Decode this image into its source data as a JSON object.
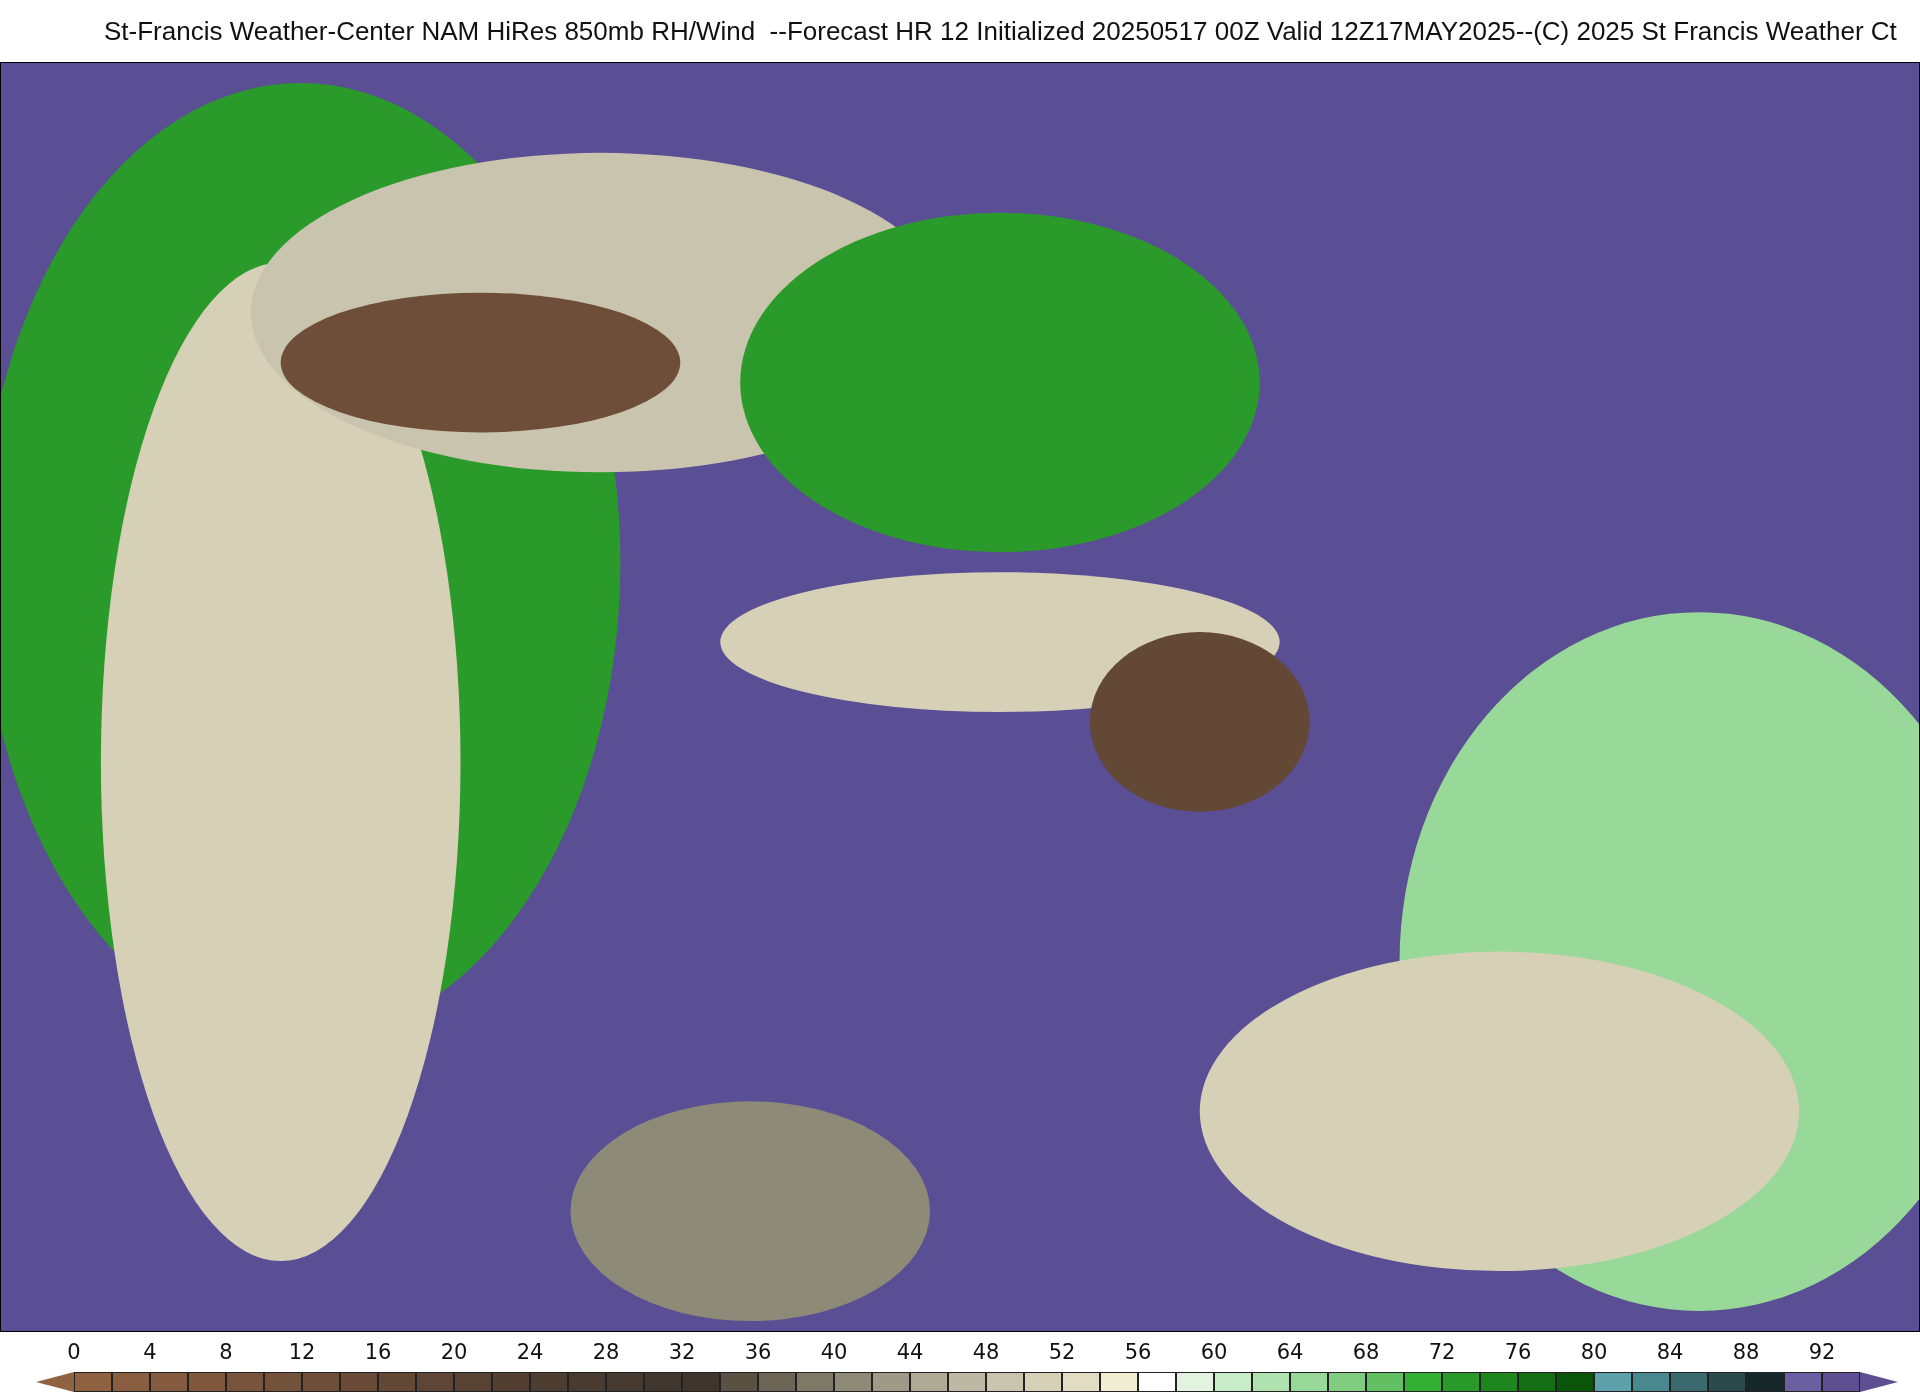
{
  "title": "St-Francis Weather-Center NAM HiRes 850mb RH/Wind  --Forecast HR 12 Initialized 20250517 00Z Valid 12Z17MAY2025--(C) 2025 St Francis Weather Ct",
  "colorbar": {
    "ticks": [
      "0",
      "4",
      "8",
      "12",
      "16",
      "20",
      "24",
      "28",
      "32",
      "36",
      "40",
      "44",
      "48",
      "52",
      "56",
      "60",
      "64",
      "68",
      "72",
      "76",
      "80",
      "84",
      "88",
      "92"
    ],
    "segments": [
      {
        "color": "#8f6242"
      },
      {
        "color": "#8a5f41"
      },
      {
        "color": "#845b3f"
      },
      {
        "color": "#7f583e"
      },
      {
        "color": "#79543c"
      },
      {
        "color": "#74513b"
      },
      {
        "color": "#6e4e39"
      },
      {
        "color": "#694b38"
      },
      {
        "color": "#634836"
      },
      {
        "color": "#5e4535"
      },
      {
        "color": "#584233"
      },
      {
        "color": "#533f32"
      },
      {
        "color": "#4e3d31"
      },
      {
        "color": "#4a3b30"
      },
      {
        "color": "#46392f"
      },
      {
        "color": "#42372e"
      },
      {
        "color": "#3f352d"
      },
      {
        "color": "#5a5142"
      },
      {
        "color": "#6c6555"
      },
      {
        "color": "#7e7867"
      },
      {
        "color": "#8e8a78"
      },
      {
        "color": "#9e9a87"
      },
      {
        "color": "#aeaa96"
      },
      {
        "color": "#bcb8a3"
      },
      {
        "color": "#c8c4ad"
      },
      {
        "color": "#d5d0b6"
      },
      {
        "color": "#e2ddc2"
      },
      {
        "color": "#f1edd3"
      },
      {
        "color": "#ffffff"
      },
      {
        "color": "#e2f3e0"
      },
      {
        "color": "#c8ebc8"
      },
      {
        "color": "#b0e2b0"
      },
      {
        "color": "#98d898"
      },
      {
        "color": "#80cc80"
      },
      {
        "color": "#62c062"
      },
      {
        "color": "#33b033"
      },
      {
        "color": "#2a9a2a"
      },
      {
        "color": "#1f851f"
      },
      {
        "color": "#146e14"
      },
      {
        "color": "#0a550a"
      },
      {
        "color": "#5fa0ad"
      },
      {
        "color": "#4a8890"
      },
      {
        "color": "#3a6a6e"
      },
      {
        "color": "#2a4a4c"
      },
      {
        "color": "#16282a"
      },
      {
        "color": "#6a5fa0"
      },
      {
        "color": "#5c5092"
      }
    ]
  }
}
